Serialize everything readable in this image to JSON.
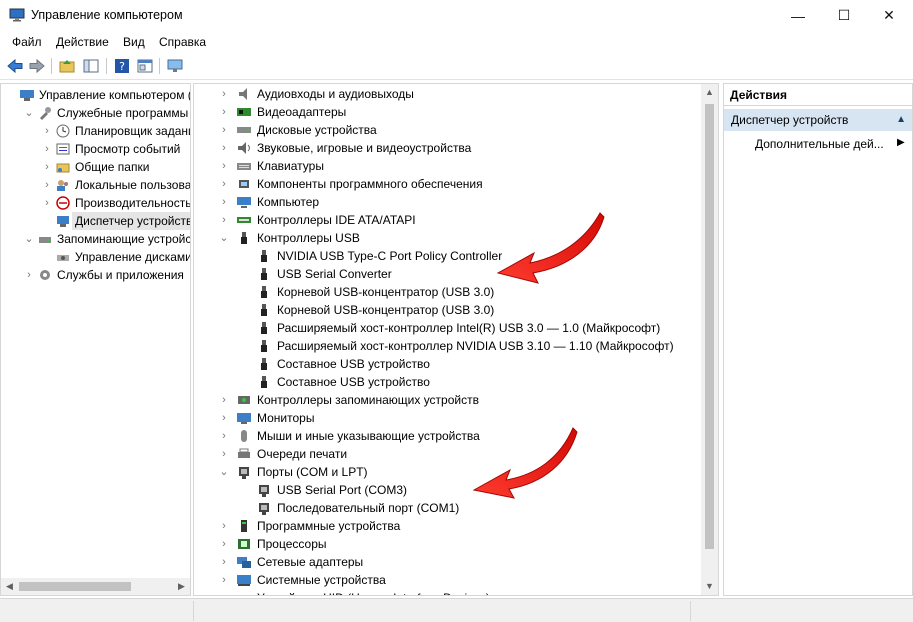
{
  "window": {
    "title": "Управление компьютером",
    "minimize": "—",
    "maximize": "☐",
    "close": "✕"
  },
  "menu": [
    "Файл",
    "Действие",
    "Вид",
    "Справка"
  ],
  "left_tree": [
    {
      "label": "Управление компьютером (л",
      "level": 0,
      "chev": "",
      "icon": "computer-management-icon"
    },
    {
      "label": "Служебные программы",
      "level": 1,
      "chev": "⌄",
      "icon": "tools-icon"
    },
    {
      "label": "Планировщик заданий",
      "level": 2,
      "chev": "›",
      "icon": "task-scheduler-icon"
    },
    {
      "label": "Просмотр событий",
      "level": 2,
      "chev": "›",
      "icon": "event-viewer-icon"
    },
    {
      "label": "Общие папки",
      "level": 2,
      "chev": "›",
      "icon": "shared-folders-icon"
    },
    {
      "label": "Локальные пользовате",
      "level": 2,
      "chev": "›",
      "icon": "local-users-icon"
    },
    {
      "label": "Производительность",
      "level": 2,
      "chev": "›",
      "icon": "performance-icon"
    },
    {
      "label": "Диспетчер устройств",
      "level": 2,
      "chev": "",
      "icon": "device-manager-icon",
      "selected": true
    },
    {
      "label": "Запоминающие устройст",
      "level": 1,
      "chev": "⌄",
      "icon": "storage-icon"
    },
    {
      "label": "Управление дисками",
      "level": 2,
      "chev": "",
      "icon": "disk-management-icon"
    },
    {
      "label": "Службы и приложения",
      "level": 1,
      "chev": "›",
      "icon": "services-icon"
    }
  ],
  "device_tree": [
    {
      "label": "Аудиовходы и аудиовыходы",
      "level": 0,
      "chev": "›",
      "icon": "speaker-icon"
    },
    {
      "label": "Видеоадаптеры",
      "level": 0,
      "chev": "›",
      "icon": "display-adapter-icon"
    },
    {
      "label": "Дисковые устройства",
      "level": 0,
      "chev": "›",
      "icon": "disk-drive-icon"
    },
    {
      "label": "Звуковые, игровые и видеоустройства",
      "level": 0,
      "chev": "›",
      "icon": "sound-icon"
    },
    {
      "label": "Клавиатуры",
      "level": 0,
      "chev": "›",
      "icon": "keyboard-icon"
    },
    {
      "label": "Компоненты программного обеспечения",
      "level": 0,
      "chev": "›",
      "icon": "software-component-icon"
    },
    {
      "label": "Компьютер",
      "level": 0,
      "chev": "›",
      "icon": "computer-icon"
    },
    {
      "label": "Контроллеры IDE ATA/ATAPI",
      "level": 0,
      "chev": "›",
      "icon": "ide-controller-icon"
    },
    {
      "label": "Контроллеры USB",
      "level": 0,
      "chev": "⌄",
      "icon": "usb-icon"
    },
    {
      "label": "NVIDIA USB Type-C Port Policy Controller",
      "level": 1,
      "chev": "",
      "icon": "usb-icon"
    },
    {
      "label": "USB Serial Converter",
      "level": 1,
      "chev": "",
      "icon": "usb-icon"
    },
    {
      "label": "Корневой USB-концентратор (USB 3.0)",
      "level": 1,
      "chev": "",
      "icon": "usb-icon"
    },
    {
      "label": "Корневой USB-концентратор (USB 3.0)",
      "level": 1,
      "chev": "",
      "icon": "usb-icon"
    },
    {
      "label": "Расширяемый хост-контроллер Intel(R) USB 3.0 — 1.0 (Майкрософт)",
      "level": 1,
      "chev": "",
      "icon": "usb-icon"
    },
    {
      "label": "Расширяемый хост-контроллер NVIDIA USB 3.10 — 1.10 (Майкрософт)",
      "level": 1,
      "chev": "",
      "icon": "usb-icon"
    },
    {
      "label": "Составное USB устройство",
      "level": 1,
      "chev": "",
      "icon": "usb-icon"
    },
    {
      "label": "Составное USB устройство",
      "level": 1,
      "chev": "",
      "icon": "usb-icon"
    },
    {
      "label": "Контроллеры запоминающих устройств",
      "level": 0,
      "chev": "›",
      "icon": "storage-controller-icon"
    },
    {
      "label": "Мониторы",
      "level": 0,
      "chev": "›",
      "icon": "monitor-icon"
    },
    {
      "label": "Мыши и иные указывающие устройства",
      "level": 0,
      "chev": "›",
      "icon": "mouse-icon"
    },
    {
      "label": "Очереди печати",
      "level": 0,
      "chev": "›",
      "icon": "printer-icon"
    },
    {
      "label": "Порты (COM и LPT)",
      "level": 0,
      "chev": "⌄",
      "icon": "port-icon"
    },
    {
      "label": "USB Serial Port (COM3)",
      "level": 1,
      "chev": "",
      "icon": "port-icon"
    },
    {
      "label": "Последовательный порт (COM1)",
      "level": 1,
      "chev": "",
      "icon": "port-icon"
    },
    {
      "label": "Программные устройства",
      "level": 0,
      "chev": "›",
      "icon": "software-device-icon"
    },
    {
      "label": "Процессоры",
      "level": 0,
      "chev": "›",
      "icon": "processor-icon"
    },
    {
      "label": "Сетевые адаптеры",
      "level": 0,
      "chev": "›",
      "icon": "network-adapter-icon"
    },
    {
      "label": "Системные устройства",
      "level": 0,
      "chev": "›",
      "icon": "system-devices-icon"
    },
    {
      "label": "Устройства HID (Human Interface Devices)",
      "level": 0,
      "chev": "›",
      "icon": "hid-icon"
    }
  ],
  "actions": {
    "header": "Действия",
    "section": "Диспетчер устройств",
    "item": "Дополнительные дей..."
  },
  "colors": {
    "annotation_arrow": "#e8120c",
    "actions_section_bg": "#d7e4f2"
  }
}
